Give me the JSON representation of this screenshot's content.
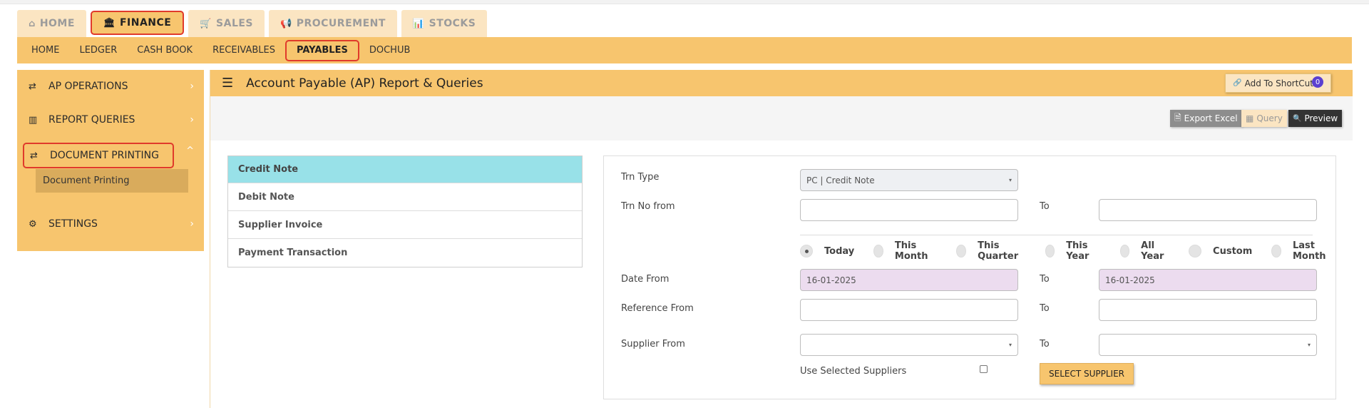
{
  "top_tabs": [
    {
      "label": "HOME",
      "icon": "home-icon",
      "glyph": "⌂"
    },
    {
      "label": "FINANCE",
      "icon": "bank-icon",
      "glyph": "🏛"
    },
    {
      "label": "SALES",
      "icon": "cart-icon",
      "glyph": "🛒"
    },
    {
      "label": "PROCUREMENT",
      "icon": "megaphone-icon",
      "glyph": "📢"
    },
    {
      "label": "STOCKS",
      "icon": "bar-chart-icon",
      "glyph": "📊"
    }
  ],
  "sub_menu": [
    "HOME",
    "LEDGER",
    "CASH BOOK",
    "RECEIVABLES",
    "PAYABLES",
    "DOCHUB"
  ],
  "sidebar": {
    "items": [
      {
        "label": "AP OPERATIONS",
        "glyph": "⇄"
      },
      {
        "label": "REPORT QUERIES",
        "glyph": "▥"
      },
      {
        "label": "DOCUMENT PRINTING",
        "glyph": "⇄"
      },
      {
        "label": "SETTINGS",
        "glyph": "⚙"
      }
    ],
    "sub_item": "Document Printing",
    "chevron_right": "›",
    "chevron_up": "^"
  },
  "header": {
    "menu_glyph": "☰",
    "title": "Account Payable (AP) Report & Queries",
    "shortcut_label": "Add To ShortCut",
    "shortcut_glyph": "🔗",
    "badge": "0"
  },
  "toolbar": {
    "export_excel": "Export Excel",
    "excel_glyph": "🗎",
    "query": "Query",
    "query_glyph": "▦",
    "preview": "Preview",
    "preview_glyph": "🔍"
  },
  "report_types": [
    "Credit Note",
    "Debit Note",
    "Supplier Invoice",
    "Payment Transaction"
  ],
  "form": {
    "trn_type_label": "Trn Type",
    "trn_type_value": "PC | Credit Note",
    "trn_no_from_label": "Trn No from",
    "to_label": "To",
    "date_options": [
      "Today",
      "This Month",
      "This Quarter",
      "This Year",
      "All Year",
      "Custom",
      "Last Month"
    ],
    "date_from_label": "Date From",
    "date_from_value": "16-01-2025",
    "date_to_value": "16-01-2025",
    "reference_from_label": "Reference From",
    "supplier_from_label": "Supplier From",
    "use_selected_label": "Use Selected Suppliers",
    "select_supplier_label": "SELECT SUPPLIER",
    "caret": "▾"
  }
}
